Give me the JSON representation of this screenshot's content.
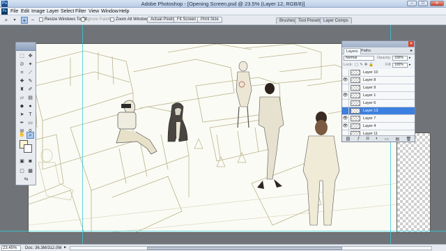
{
  "window": {
    "app_title": "Adobe Photoshop",
    "doc_title": "[Opening Screen.psd @ 23.5% (Layer 12, RGB/8)]",
    "minimize_label": "–",
    "maximize_label": "□",
    "close_label": "✕"
  },
  "menubar": {
    "items": [
      "File",
      "Edit",
      "Image",
      "Layer",
      "Select",
      "Filter",
      "View",
      "Window",
      "Help"
    ]
  },
  "options": {
    "resize_windows_label": "Resize Windows To Fit",
    "ignore_palettes_label": "Ignore Palettes",
    "zoom_all_windows_label": "Zoom All Windows",
    "actual_pixels_label": "Actual Pixels",
    "fit_screen_label": "Fit Screen",
    "print_size_label": "Print Size"
  },
  "panel_tabs": [
    "Brushes",
    "Tool Presets",
    "Layer Comps"
  ],
  "layers_panel": {
    "tabs": [
      "Layers",
      "Paths"
    ],
    "blend_mode": "Normal",
    "opacity_label": "Opacity:",
    "opacity_value": "100%",
    "lock_label": "Lock:",
    "fill_label": "Fill:",
    "fill_value": "100%",
    "layers": [
      {
        "name": "Layer 10",
        "visible": false,
        "selected": false
      },
      {
        "name": "Layer 8",
        "visible": true,
        "selected": false
      },
      {
        "name": "Layer 9",
        "visible": false,
        "selected": false
      },
      {
        "name": "Layer 1",
        "visible": true,
        "selected": false
      },
      {
        "name": "Layer 6",
        "visible": false,
        "selected": false
      },
      {
        "name": "Layer 13",
        "visible": false,
        "selected": true
      },
      {
        "name": "Layer 7",
        "visible": true,
        "selected": false
      },
      {
        "name": "Layer 4",
        "visible": true,
        "selected": false
      },
      {
        "name": "Layer 11",
        "visible": false,
        "selected": false
      }
    ]
  },
  "status": {
    "zoom": "23.45%",
    "doc_info": "Doc: 36.3M/312.0M"
  },
  "colors": {
    "foreground": "#fff7d2",
    "background": "#ffffff",
    "selection": "#3d7fe0",
    "guides": "#36c8d6"
  }
}
